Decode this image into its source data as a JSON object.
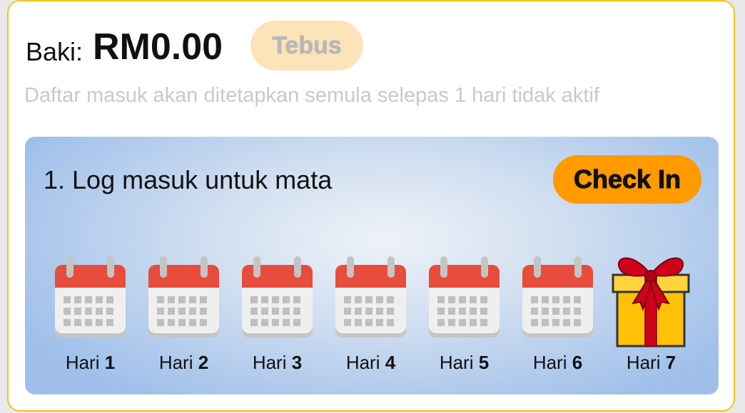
{
  "balance": {
    "label": "Baki:",
    "value": "RM0.00"
  },
  "redeem_label": "Tebus",
  "notice": "Daftar masuk akan ditetapkan semula selepas 1 hari tidak aktif",
  "task": {
    "title": "1. Log masuk untuk mata",
    "checkin_label": "Check In"
  },
  "days": [
    {
      "prefix": "Hari",
      "number": "1",
      "icon": "calendar-icon"
    },
    {
      "prefix": "Hari",
      "number": "2",
      "icon": "calendar-icon"
    },
    {
      "prefix": "Hari",
      "number": "3",
      "icon": "calendar-icon"
    },
    {
      "prefix": "Hari",
      "number": "4",
      "icon": "calendar-icon"
    },
    {
      "prefix": "Hari",
      "number": "5",
      "icon": "calendar-icon"
    },
    {
      "prefix": "Hari",
      "number": "6",
      "icon": "calendar-icon"
    },
    {
      "prefix": "Hari",
      "number": "7",
      "icon": "gift-icon"
    }
  ],
  "colors": {
    "border_accent": "#f5c518",
    "checkin": "#ff9a00",
    "redeem_disabled": "#fde3b8",
    "calendar_header": "#e84c3d",
    "gift_box": "#ffc107",
    "gift_ribbon": "#d0021b"
  }
}
